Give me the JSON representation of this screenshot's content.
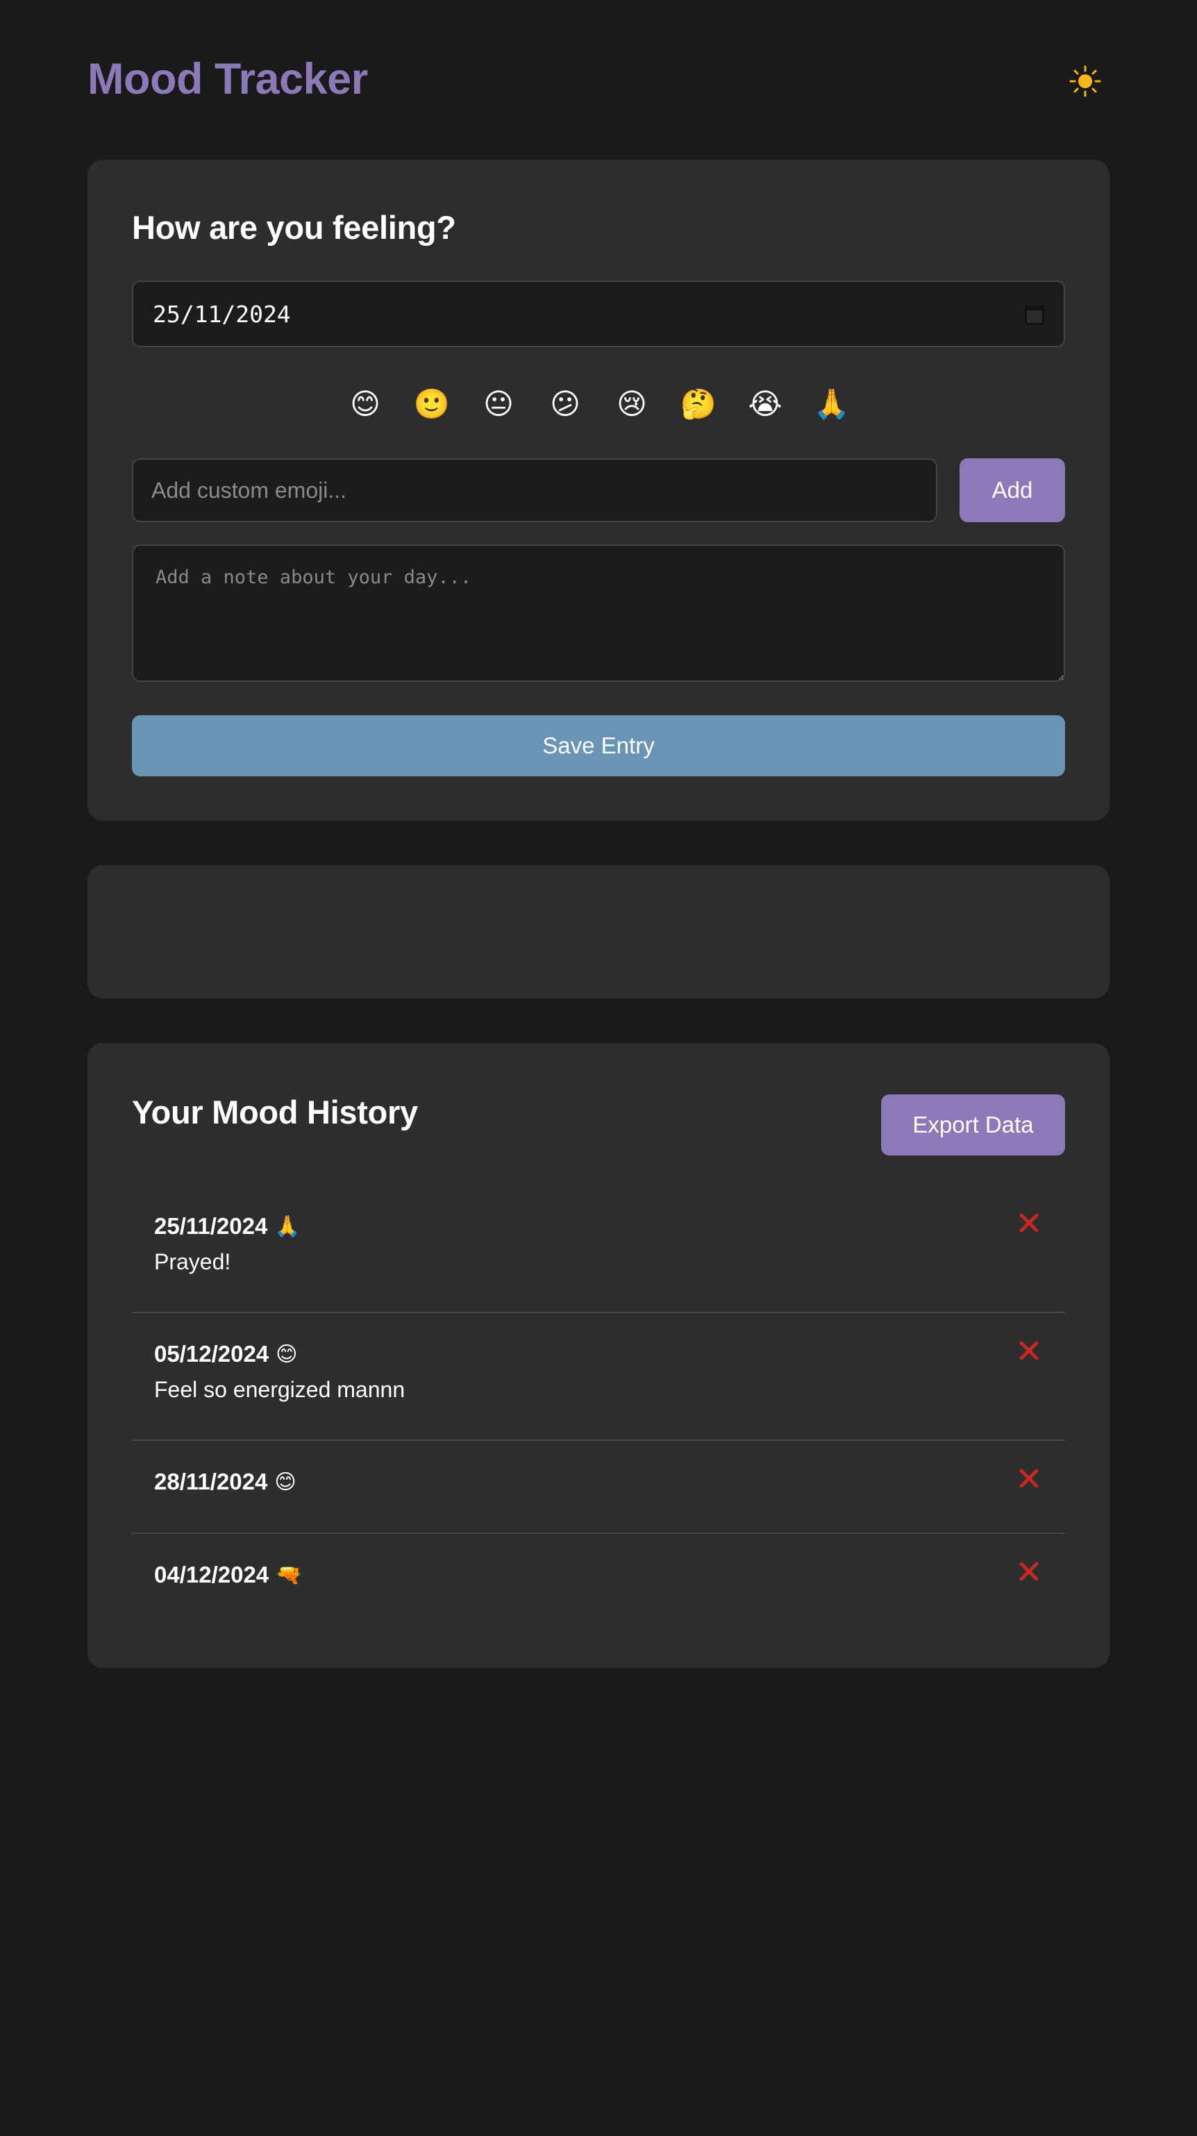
{
  "header": {
    "title": "Mood Tracker",
    "theme_icon": "sun-icon"
  },
  "entry_form": {
    "heading": "How are you feeling?",
    "date_value": "25/11/2024",
    "emoji_options": [
      "😊",
      "🙂",
      "😐",
      "😕",
      "😢",
      "🤔",
      "😭",
      "🙏"
    ],
    "custom_emoji_placeholder": "Add custom emoji...",
    "add_label": "Add",
    "note_placeholder": "Add a note about your day...",
    "save_label": "Save Entry"
  },
  "history": {
    "heading": "Your Mood History",
    "export_label": "Export Data",
    "entries": [
      {
        "date": "25/11/2024",
        "emoji": "🙏",
        "note": "Prayed!"
      },
      {
        "date": "05/12/2024",
        "emoji": "😊",
        "note": "Feel so energized mannn"
      },
      {
        "date": "28/11/2024",
        "emoji": "😊",
        "note": ""
      },
      {
        "date": "04/12/2024",
        "emoji": "🔫",
        "note": ""
      }
    ]
  },
  "colors": {
    "background": "#1a1a1a",
    "card": "#2d2d2d",
    "accent_purple": "#8b79b8",
    "save_blue": "#6a94b4",
    "delete_red": "#c62828"
  }
}
